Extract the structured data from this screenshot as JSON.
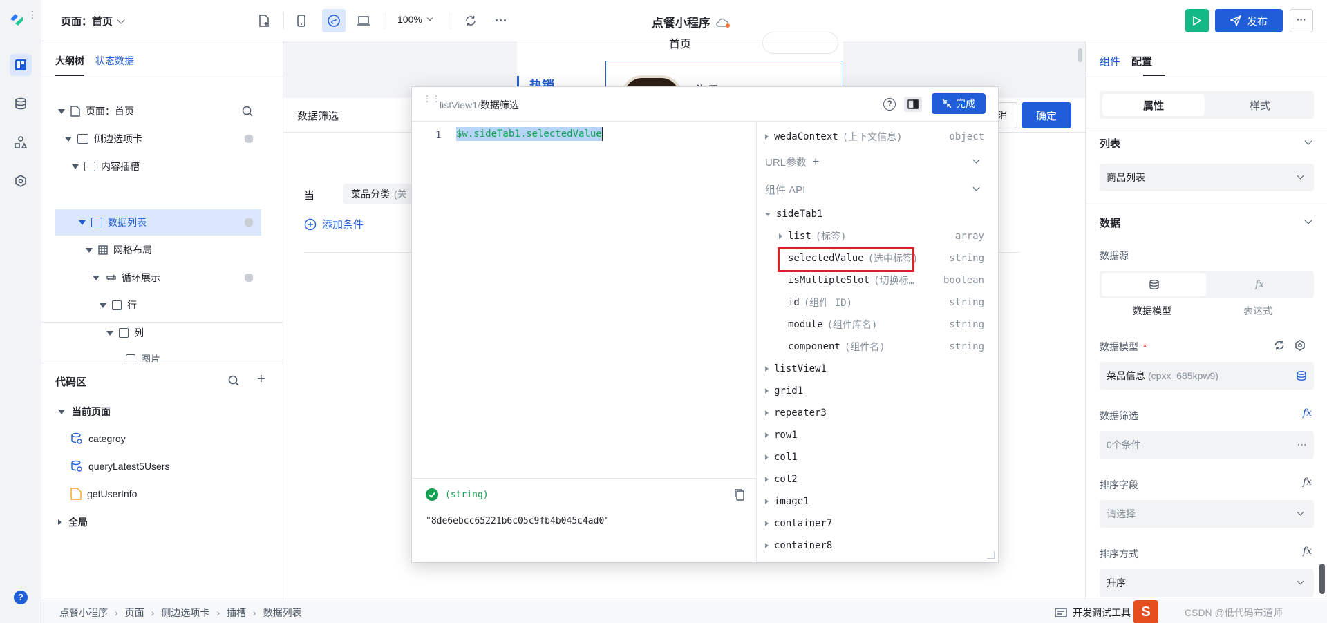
{
  "topbar": {
    "page_selector": "页面：首页",
    "zoom": "100%",
    "app_title": "点餐小程序",
    "publish_label": "发布"
  },
  "left_panel": {
    "tabs": [
      "大纲树",
      "状态数据"
    ],
    "tree": [
      {
        "label": "页面：首页"
      },
      {
        "label": "侧边选项卡"
      },
      {
        "label": "内容插槽"
      },
      {
        "label": "数据列表"
      },
      {
        "label": "网格布局"
      },
      {
        "label": "循环展示"
      },
      {
        "label": "行"
      },
      {
        "label": "列"
      },
      {
        "label": "图片"
      }
    ],
    "code_area": {
      "title": "代码区",
      "current_page": "当前页面",
      "items": [
        "categroy",
        "queryLatest5Users",
        "getUserInfo"
      ],
      "global": "全局"
    }
  },
  "canvas": {
    "preview_top": "首页",
    "preview_hot": "热销",
    "preview_item": "泡便",
    "filter_title": "数据筛选",
    "condition_when": "当",
    "condition_field": "菜品分类",
    "condition_field_suffix": "(关",
    "add_condition": "添加条件",
    "cancel_label": "消",
    "confirm_label": "确定"
  },
  "modal": {
    "breadcrumb_parent": "listView1",
    "breadcrumb_sep": "/",
    "breadcrumb_current": "数据筛选",
    "done_label": "完成",
    "code_line_number": "1",
    "code": "$w.sideTab1.selectedValue",
    "result_type": "(string)",
    "result_value": "\"8de6ebcc65221b6c05c9fb4b045c4ad0\"",
    "api": {
      "weda_context": {
        "name": "wedaContext",
        "desc": "(上下文信息)",
        "type": "object"
      },
      "url_params": "URL参数",
      "component_api": "组件 API",
      "side_tab": "sideTab1",
      "props": [
        {
          "name": "list",
          "desc": "(标签)",
          "type": "array"
        },
        {
          "name": "selectedValue",
          "desc": "(选中标签)",
          "type": "string"
        },
        {
          "name": "isMultipleSlot",
          "desc": "(切换标…",
          "type": "boolean"
        },
        {
          "name": "id",
          "desc": "(组件 ID)",
          "type": "string"
        },
        {
          "name": "module",
          "desc": "(组件库名)",
          "type": "string"
        },
        {
          "name": "component",
          "desc": "(组件名)",
          "type": "string"
        }
      ],
      "components": [
        "listView1",
        "grid1",
        "repeater3",
        "row1",
        "col1",
        "col2",
        "image1",
        "container7",
        "container8"
      ]
    }
  },
  "right_panel": {
    "tabs": [
      "组件",
      "配置"
    ],
    "seg": [
      "属性",
      "样式"
    ],
    "list_section": "列表",
    "list_value": "商品列表",
    "data_section": "数据",
    "datasource_label": "数据源",
    "datasource_options": [
      "数据模型",
      "表达式"
    ],
    "data_model_label": "数据模型",
    "required_mark": "*",
    "data_model_value": "菜品信息",
    "data_model_id": "(cpxx_685kpw9)",
    "data_filter_label": "数据筛选",
    "data_filter_value": "0个条件",
    "sort_field_label": "排序字段",
    "sort_field_placeholder": "请选择",
    "sort_order_label": "排序方式",
    "sort_order_value": "升序",
    "fx_label": "fx"
  },
  "statusbar": {
    "breadcrumb": [
      "点餐小程序",
      "页面",
      "侧边选项卡",
      "插槽",
      "数据列表"
    ],
    "devtools": "开发调试工具",
    "watermark": "CSDN @低代码布道师"
  },
  "colors": {
    "primary": "#1f5ed8",
    "run_green": "#12b886",
    "highlight_red": "#d9242b",
    "success": "#12a150"
  }
}
